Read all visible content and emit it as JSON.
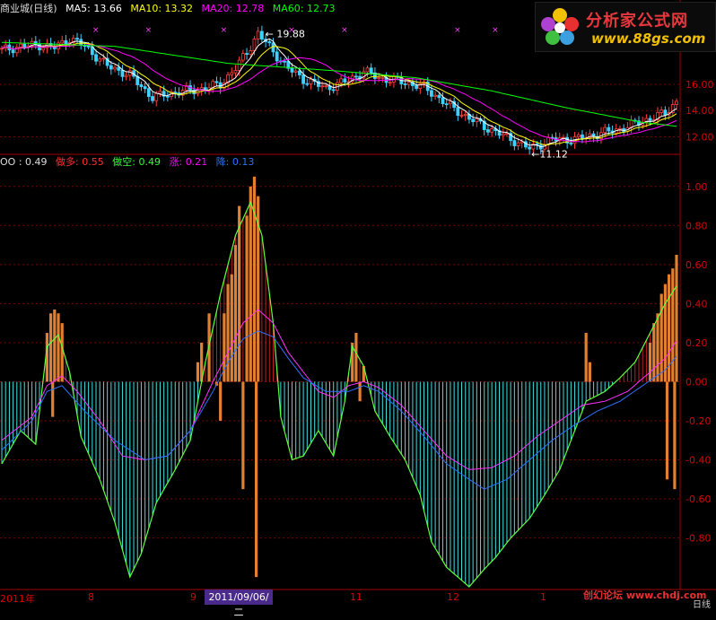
{
  "header_top": {
    "name": "商业城(日线)",
    "ma5": {
      "label": "MA5:",
      "value": "13.66",
      "color": "#ffffff"
    },
    "ma10": {
      "label": "MA10:",
      "value": "13.32",
      "color": "#ffff00"
    },
    "ma20": {
      "label": "MA20:",
      "value": "12.78",
      "color": "#ff00ff"
    },
    "ma60": {
      "label": "MA60:",
      "value": "12.73",
      "color": "#00ff00"
    }
  },
  "header_bottom": {
    "main": {
      "label": "OO :",
      "value": "0.49",
      "color": "#dddddd"
    },
    "zuoduo": {
      "label": "做多:",
      "value": "0.55",
      "color": "#ff3030"
    },
    "zuokong": {
      "label": "做空:",
      "value": "0.49",
      "color": "#30ff30"
    },
    "zhang": {
      "label": "涨:",
      "value": "0.21",
      "color": "#ff00ff"
    },
    "jiang": {
      "label": "降:",
      "value": "0.13",
      "color": "#3070ff"
    }
  },
  "logo": {
    "title": "分析家公式网",
    "url": "www.88gs.com"
  },
  "x_axis": {
    "labels": [
      "2011年",
      "8",
      "9",
      "11",
      "12",
      "1"
    ],
    "highlight": "2011/09/06/二"
  },
  "footer": {
    "text": "创幻论坛 www.chdj.com",
    "mode": "日线"
  },
  "chart_data": [
    {
      "type": "line",
      "title": "K线",
      "ylim": [
        10.8,
        21.2
      ],
      "ticks": [
        "16.00",
        "14.00",
        "12.00"
      ],
      "annotations": [
        "19.88",
        "11.12"
      ],
      "series": [
        {
          "name": "MA5",
          "color": "#ffffff"
        },
        {
          "name": "MA10",
          "color": "#ffff00"
        },
        {
          "name": "MA20",
          "color": "#ff00ff"
        },
        {
          "name": "MA60",
          "color": "#00ff00"
        }
      ],
      "x_count": 180,
      "price_keys": [
        [
          0,
          18.6
        ],
        [
          5,
          18.9
        ],
        [
          10,
          19.0
        ],
        [
          14,
          18.8
        ],
        [
          18,
          19.5
        ],
        [
          22,
          18.9
        ],
        [
          28,
          17.4
        ],
        [
          34,
          16.7
        ],
        [
          40,
          15.0
        ],
        [
          46,
          15.4
        ],
        [
          52,
          15.6
        ],
        [
          58,
          16.0
        ],
        [
          62,
          17.2
        ],
        [
          66,
          18.9
        ],
        [
          68,
          19.9
        ],
        [
          72,
          18.5
        ],
        [
          76,
          17.2
        ],
        [
          80,
          16.4
        ],
        [
          86,
          15.7
        ],
        [
          92,
          16.3
        ],
        [
          96,
          17.0
        ],
        [
          100,
          16.5
        ],
        [
          106,
          16.2
        ],
        [
          112,
          15.8
        ],
        [
          118,
          14.5
        ],
        [
          124,
          13.4
        ],
        [
          130,
          12.5
        ],
        [
          136,
          11.7
        ],
        [
          140,
          11.1
        ],
        [
          146,
          11.8
        ],
        [
          152,
          11.8
        ],
        [
          158,
          12.2
        ],
        [
          164,
          12.6
        ],
        [
          170,
          13.2
        ],
        [
          176,
          13.8
        ],
        [
          179,
          14.7
        ]
      ],
      "ma60_keys": [
        [
          0,
          19.2
        ],
        [
          30,
          18.9
        ],
        [
          60,
          17.6
        ],
        [
          90,
          17.0
        ],
        [
          110,
          16.5
        ],
        [
          130,
          15.5
        ],
        [
          150,
          14.2
        ],
        [
          170,
          13.1
        ],
        [
          179,
          12.8
        ]
      ]
    },
    {
      "type": "bar",
      "title": "OO",
      "ylim": [
        -1.05,
        1.1
      ],
      "ticks": [
        "1.00",
        "0.80",
        "0.60",
        "0.40",
        "0.20",
        "0.00",
        "-0.20",
        "-0.40",
        "-0.60",
        "-0.80"
      ],
      "x_count": 180,
      "oo_keys": [
        [
          0,
          -0.42
        ],
        [
          5,
          -0.25
        ],
        [
          9,
          -0.32
        ],
        [
          12,
          0.18
        ],
        [
          15,
          0.24
        ],
        [
          18,
          0.05
        ],
        [
          21,
          -0.28
        ],
        [
          26,
          -0.5
        ],
        [
          30,
          -0.72
        ],
        [
          34,
          -1.0
        ],
        [
          37,
          -0.88
        ],
        [
          41,
          -0.62
        ],
        [
          46,
          -0.45
        ],
        [
          50,
          -0.3
        ],
        [
          54,
          0.1
        ],
        [
          58,
          0.45
        ],
        [
          62,
          0.75
        ],
        [
          66,
          0.92
        ],
        [
          69,
          0.75
        ],
        [
          72,
          0.3
        ],
        [
          74,
          -0.18
        ],
        [
          77,
          -0.4
        ],
        [
          80,
          -0.38
        ],
        [
          84,
          -0.25
        ],
        [
          88,
          -0.38
        ],
        [
          91,
          -0.1
        ],
        [
          93,
          0.18
        ],
        [
          96,
          0.08
        ],
        [
          99,
          -0.15
        ],
        [
          103,
          -0.28
        ],
        [
          107,
          -0.4
        ],
        [
          111,
          -0.58
        ],
        [
          114,
          -0.82
        ],
        [
          118,
          -0.95
        ],
        [
          121,
          -1.0
        ],
        [
          124,
          -1.05
        ],
        [
          128,
          -0.96
        ],
        [
          131,
          -0.9
        ],
        [
          135,
          -0.8
        ],
        [
          140,
          -0.7
        ],
        [
          144,
          -0.58
        ],
        [
          148,
          -0.45
        ],
        [
          152,
          -0.25
        ],
        [
          155,
          -0.1
        ],
        [
          160,
          -0.05
        ],
        [
          164,
          0.02
        ],
        [
          168,
          0.1
        ],
        [
          172,
          0.25
        ],
        [
          176,
          0.4
        ],
        [
          179,
          0.49
        ]
      ],
      "zhang_keys": [
        [
          0,
          -0.3
        ],
        [
          8,
          -0.18
        ],
        [
          12,
          -0.02
        ],
        [
          16,
          0.03
        ],
        [
          20,
          -0.05
        ],
        [
          26,
          -0.2
        ],
        [
          32,
          -0.38
        ],
        [
          38,
          -0.4
        ],
        [
          44,
          -0.38
        ],
        [
          50,
          -0.25
        ],
        [
          56,
          0.0
        ],
        [
          60,
          0.15
        ],
        [
          64,
          0.3
        ],
        [
          68,
          0.37
        ],
        [
          72,
          0.3
        ],
        [
          76,
          0.15
        ],
        [
          80,
          0.05
        ],
        [
          84,
          -0.05
        ],
        [
          88,
          -0.08
        ],
        [
          92,
          -0.02
        ],
        [
          96,
          0.0
        ],
        [
          100,
          -0.03
        ],
        [
          106,
          -0.12
        ],
        [
          112,
          -0.25
        ],
        [
          118,
          -0.38
        ],
        [
          124,
          -0.45
        ],
        [
          130,
          -0.44
        ],
        [
          136,
          -0.38
        ],
        [
          142,
          -0.28
        ],
        [
          148,
          -0.2
        ],
        [
          154,
          -0.12
        ],
        [
          160,
          -0.1
        ],
        [
          166,
          -0.05
        ],
        [
          172,
          0.05
        ],
        [
          176,
          0.12
        ],
        [
          179,
          0.21
        ]
      ],
      "jiang_keys": [
        [
          0,
          -0.35
        ],
        [
          8,
          -0.2
        ],
        [
          12,
          -0.05
        ],
        [
          16,
          -0.02
        ],
        [
          22,
          -0.15
        ],
        [
          30,
          -0.3
        ],
        [
          38,
          -0.4
        ],
        [
          44,
          -0.38
        ],
        [
          50,
          -0.25
        ],
        [
          56,
          -0.05
        ],
        [
          60,
          0.1
        ],
        [
          64,
          0.22
        ],
        [
          68,
          0.26
        ],
        [
          72,
          0.23
        ],
        [
          76,
          0.12
        ],
        [
          80,
          0.02
        ],
        [
          86,
          -0.05
        ],
        [
          92,
          -0.05
        ],
        [
          96,
          -0.02
        ],
        [
          100,
          -0.05
        ],
        [
          106,
          -0.15
        ],
        [
          112,
          -0.28
        ],
        [
          118,
          -0.42
        ],
        [
          124,
          -0.5
        ],
        [
          128,
          -0.55
        ],
        [
          134,
          -0.5
        ],
        [
          140,
          -0.4
        ],
        [
          146,
          -0.3
        ],
        [
          152,
          -0.22
        ],
        [
          158,
          -0.15
        ],
        [
          164,
          -0.1
        ],
        [
          170,
          -0.02
        ],
        [
          176,
          0.06
        ],
        [
          179,
          0.13
        ]
      ],
      "orange_keys": [
        [
          12,
          0.25
        ],
        [
          13,
          0.35
        ],
        [
          14,
          0.37
        ],
        [
          15,
          0.35
        ],
        [
          16,
          0.3
        ],
        [
          13.5,
          -0.18
        ],
        [
          52,
          0.1
        ],
        [
          53,
          0.2
        ],
        [
          55,
          0.35
        ],
        [
          57,
          -0.02
        ],
        [
          58,
          -0.2
        ],
        [
          59,
          0.35
        ],
        [
          60,
          0.5
        ],
        [
          61,
          0.55
        ],
        [
          62,
          0.7
        ],
        [
          63,
          0.9
        ],
        [
          64,
          -0.55
        ],
        [
          65,
          0.85
        ],
        [
          66,
          1.0
        ],
        [
          67,
          1.05
        ],
        [
          67.5,
          -1.0
        ],
        [
          68,
          0.95
        ],
        [
          93,
          0.2
        ],
        [
          94,
          0.25
        ],
        [
          95,
          -0.1
        ],
        [
          96,
          0.08
        ],
        [
          155,
          0.25
        ],
        [
          156,
          0.1
        ],
        [
          172,
          0.2
        ],
        [
          173,
          0.3
        ],
        [
          174,
          0.35
        ],
        [
          175,
          0.45
        ],
        [
          176,
          0.5
        ],
        [
          177,
          0.55
        ],
        [
          178,
          0.58
        ],
        [
          179,
          0.65
        ],
        [
          176.5,
          -0.5
        ],
        [
          178.5,
          -0.55
        ]
      ]
    }
  ]
}
